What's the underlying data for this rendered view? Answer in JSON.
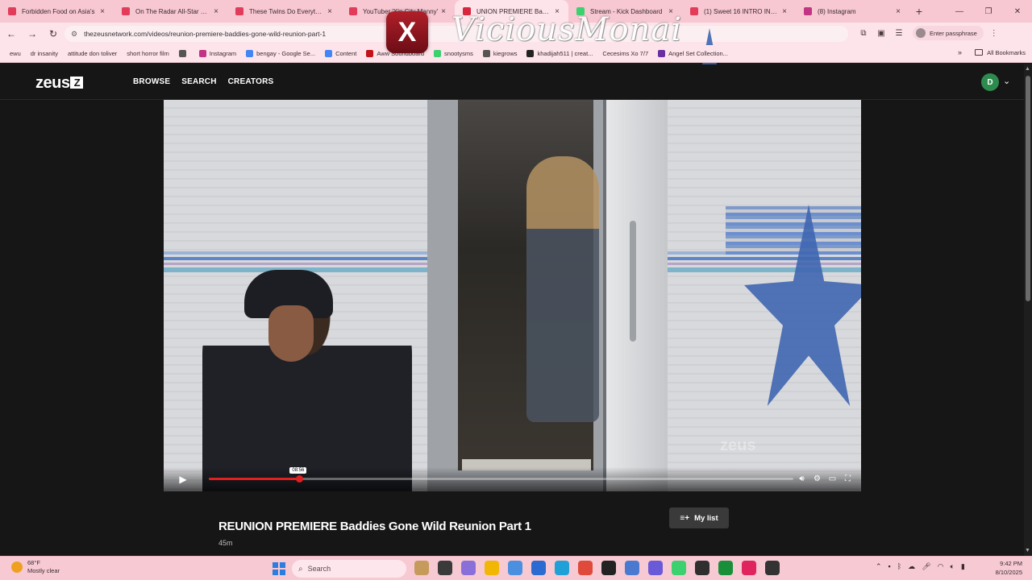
{
  "browser": {
    "tabs": [
      {
        "title": "Forbidden Food on Asia's",
        "color": "#e33b5a",
        "active": false
      },
      {
        "title": "On The Radar All-Star Cypher",
        "color": "#e33b5a",
        "active": false
      },
      {
        "title": "These Twins Do Everything",
        "color": "#e33b5a",
        "active": false
      },
      {
        "title": "YouTuber 'Xin City Manny'",
        "color": "#e33b5a",
        "active": false
      },
      {
        "title": "UNION PREMIERE Baddies",
        "color": "#d7263d",
        "active": true
      },
      {
        "title": "Stream - Kick Dashboard",
        "color": "#3bd16f",
        "active": false
      },
      {
        "title": "(1) Sweet 16 INTRO INVITE",
        "color": "#e33b5a",
        "active": false
      },
      {
        "title": "(8) Instagram",
        "color": "#c13584",
        "active": false
      }
    ],
    "url": "thezeusnetwork.com/videos/reunion-premiere-baddies-gone-wild-reunion-part-1",
    "passphrase_label": "Enter passphrase",
    "bookmarks": [
      {
        "label": "ewu",
        "color": ""
      },
      {
        "label": "dr insanity",
        "color": ""
      },
      {
        "label": "attitude don toliver",
        "color": ""
      },
      {
        "label": "short horror film",
        "color": ""
      },
      {
        "label": "",
        "color": "#555555"
      },
      {
        "label": "Instagram",
        "color": "#c13584"
      },
      {
        "label": "bengay - Google Se...",
        "color": "#4285f4"
      },
      {
        "label": "Content",
        "color": "#4285f4"
      },
      {
        "label": "Aww Soundboard",
        "color": "#c4121a"
      },
      {
        "label": "snootysms",
        "color": "#3bd16f"
      },
      {
        "label": "kiegrows",
        "color": "#555555"
      },
      {
        "label": "khadijah511 | creat...",
        "color": "#222222"
      },
      {
        "label": "Cecesims Xo 7/7",
        "color": ""
      },
      {
        "label": "Angel Set Collection...",
        "color": "#6a2fa0"
      }
    ],
    "all_bookmarks_label": "All Bookmarks"
  },
  "overlay": {
    "x_logo": "X",
    "signature": "ViciousMonai"
  },
  "site": {
    "logo": "zeus",
    "logo_mark": "Z",
    "nav": [
      "BROWSE",
      "SEARCH",
      "CREATORS"
    ],
    "avatar_initial": "D",
    "video_watermark": "zeus"
  },
  "player": {
    "progress_fraction": 0.155,
    "time_tooltip": "08:56"
  },
  "video": {
    "title": "REUNION PREMIERE Baddies Gone Wild Reunion Part 1",
    "duration": "45m",
    "my_list_label": "My list"
  },
  "taskbar": {
    "weather_temp": "68°F",
    "weather_desc": "Mostly clear",
    "search_placeholder": "Search",
    "apps": [
      "#c69a5a",
      "#3a3a3a",
      "#8a6fd8",
      "#f2b705",
      "#4a8fe0",
      "#2b6ad0",
      "#1fa1d8",
      "#e04a3a",
      "#222222",
      "#4a7ad0",
      "#6a5ad8",
      "#3bd16f",
      "#2f2f2f",
      "#1a8f3a",
      "#e0245e",
      "#333333"
    ],
    "time": "9:42 PM",
    "date": "8/10/2025"
  }
}
